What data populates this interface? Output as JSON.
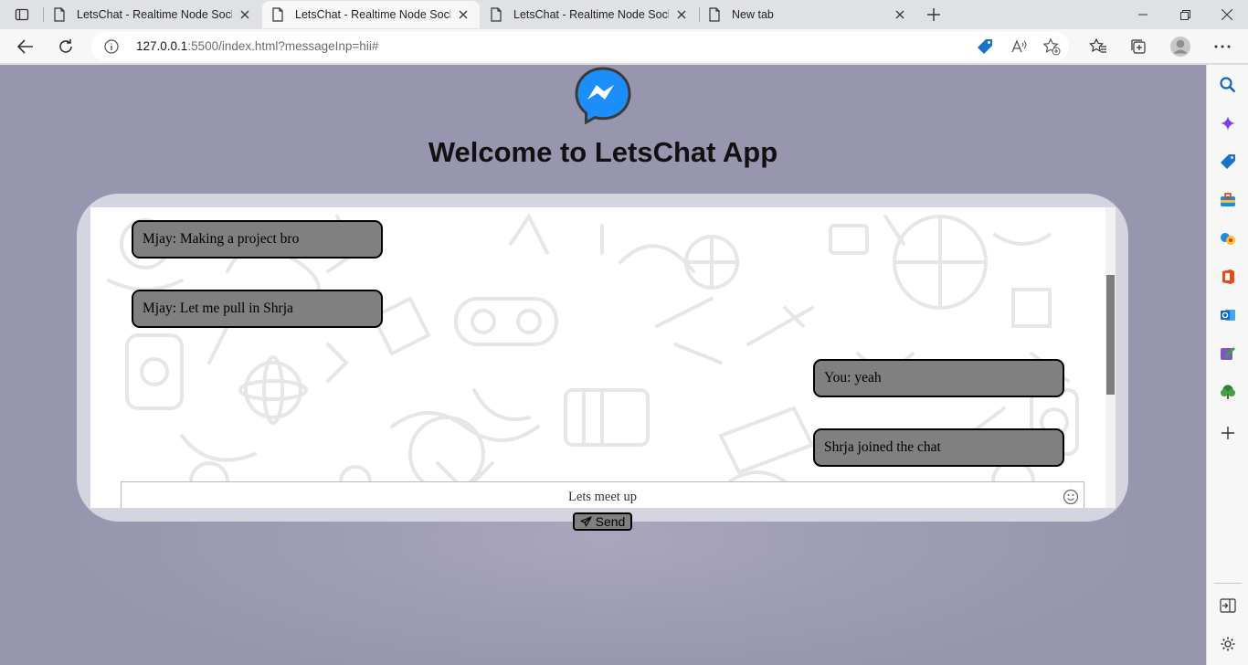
{
  "browser": {
    "tabs": [
      {
        "title": "LetsChat - Realtime Node Socket.io App",
        "active": false
      },
      {
        "title": "LetsChat - Realtime Node Socket.io App",
        "active": true
      },
      {
        "title": "LetsChat - Realtime Node Socket.io App",
        "active": false
      },
      {
        "title": "New tab",
        "active": false
      }
    ],
    "address": {
      "host": "127.0.0.1",
      "rest": ":5500/index.html?messageInp=hii#"
    }
  },
  "page": {
    "title": "Welcome to LetsChat App",
    "messages": [
      {
        "text": "Mjay: Making a project bro",
        "side": "left"
      },
      {
        "text": "Mjay: Let me pull in Shrja",
        "side": "left"
      },
      {
        "text": "You: yeah",
        "side": "right"
      },
      {
        "text": "Shrja joined the chat",
        "side": "right"
      }
    ],
    "input_value": "Lets meet up",
    "send_label": "Send"
  },
  "colors": {
    "page_bg": "#9d9cb3",
    "bubble": "#808080",
    "messenger_blue": "#1c8ef9"
  }
}
